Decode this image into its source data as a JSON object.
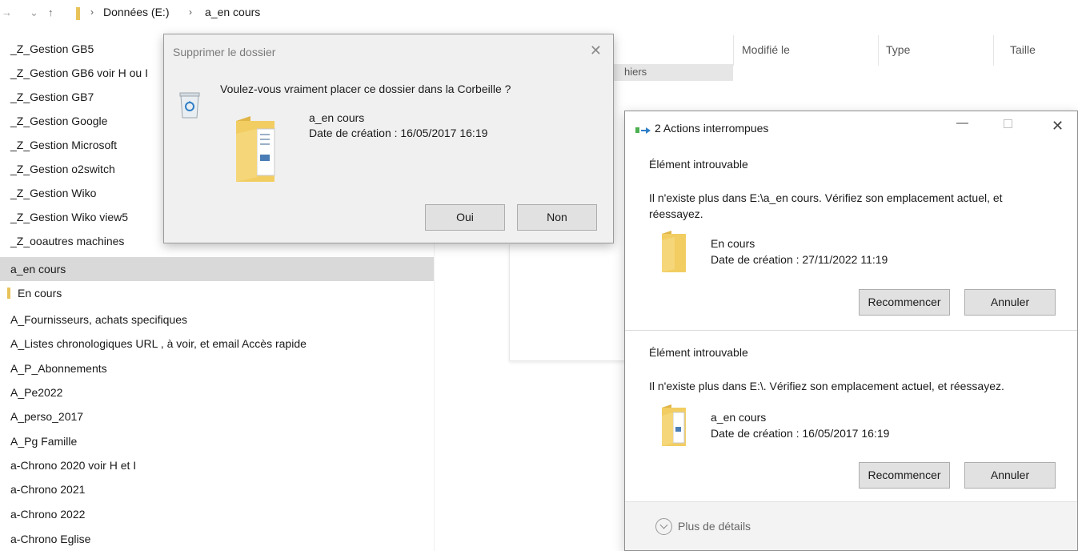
{
  "breadcrumb": {
    "back_icon": "arrow-right-icon",
    "dropdown_icon": "chevron-down-icon",
    "up_icon": "arrow-up-icon",
    "items": [
      "Données (E:)",
      "a_en cours"
    ]
  },
  "nav": {
    "items": [
      "_Z_Gestion GB5",
      "_Z_Gestion GB6 voir H ou I",
      "_Z_Gestion GB7",
      "_Z_Gestion Google",
      "_Z_Gestion Microsoft",
      "_Z_Gestion o2switch",
      "_Z_Gestion Wiko",
      "_Z_Gestion Wiko view5",
      "_Z_ooautres machines",
      "a_en cours",
      "En cours",
      "A_Fournisseurs, achats specifiques",
      "A_Listes chronologiques URL , à voir, et email Accès rapide",
      "A_P_Abonnements",
      "A_Pe2022",
      "A_perso_2017",
      "A_Pg Famille",
      "a-Chrono 2020 voir H et I",
      "a-Chrono 2021",
      "a-Chrono 2022",
      "a-Chrono Eglise"
    ],
    "selected": "a_en cours"
  },
  "file_list": {
    "columns": [
      "Modifié le",
      "Type",
      "Taille"
    ],
    "strip_text": "hiers"
  },
  "delete_dialog": {
    "title": "Supprimer le dossier",
    "close_icon": "close-icon",
    "question": "Voulez-vous vraiment placer ce dossier dans la Corbeille ?",
    "folder_name": "a_en cours",
    "folder_date": "Date de création : 16/05/2017 16:19",
    "yes_label": "Oui",
    "no_label": "Non"
  },
  "actions_dialog": {
    "title": "2 Actions interrompues",
    "sections": [
      {
        "title": "Élément introuvable",
        "message": "Il n'existe plus dans E:\\a_en cours. Vérifiez son emplacement actuel, et réessayez.",
        "item_name": "En cours",
        "item_date": "Date de création : 27/11/2022 11:19",
        "retry_label": "Recommencer",
        "cancel_label": "Annuler"
      },
      {
        "title": "Élément introuvable",
        "message": "Il n'existe plus dans E:\\. Vérifiez son emplacement actuel, et réessayez.",
        "item_name": "a_en cours",
        "item_date": "Date de création : 16/05/2017 16:19",
        "retry_label": "Recommencer",
        "cancel_label": "Annuler"
      }
    ],
    "details_label": "Plus de détails"
  },
  "colors": {
    "folder": "#f2cd62",
    "selection": "#d9d9d9",
    "button": "#e1e1e1",
    "dialog_bg": "#f0f0f0"
  }
}
